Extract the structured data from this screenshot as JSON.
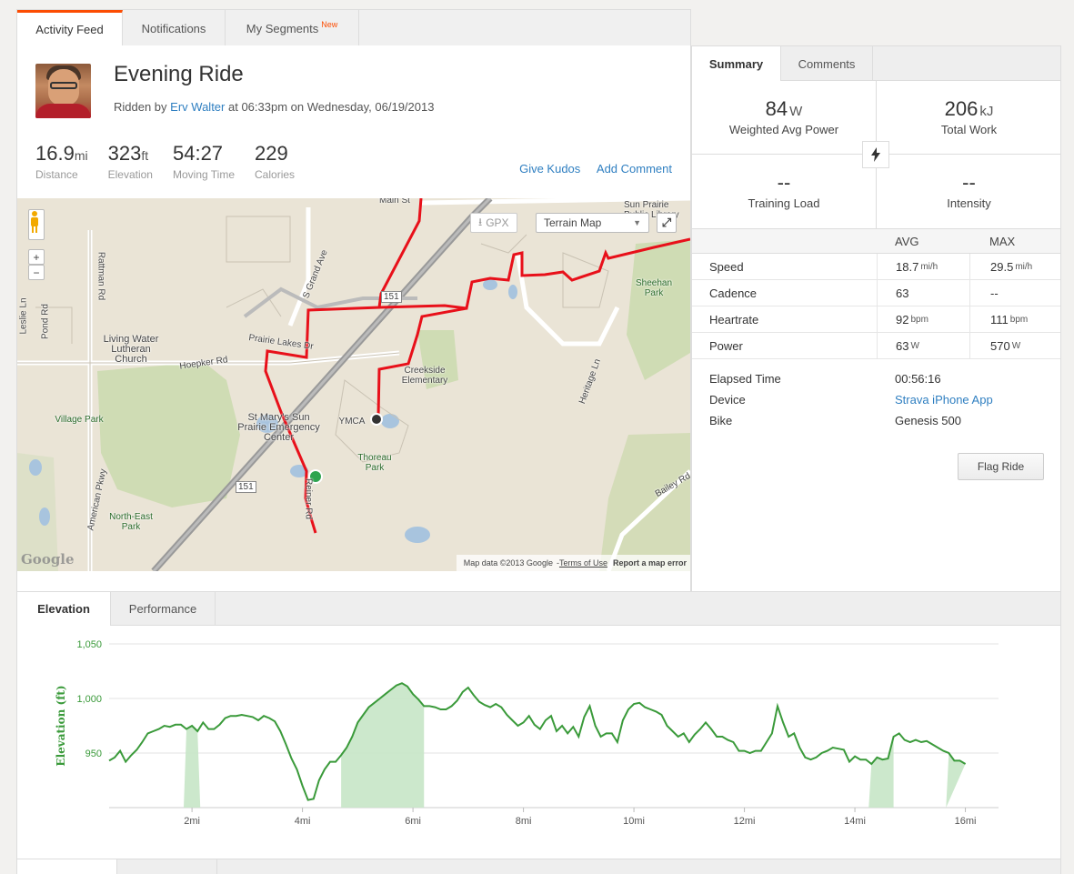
{
  "top_tabs": [
    {
      "label": "Activity Feed"
    },
    {
      "label": "Notifications"
    },
    {
      "label": "My Segments",
      "badge": "New"
    }
  ],
  "activity": {
    "title": "Evening Ride",
    "ridden_by_prefix": "Ridden by",
    "athlete": "Erv Walter",
    "when": "at 06:33pm on Wednesday, 06/19/2013",
    "stats": [
      {
        "value": "16.9",
        "unit": "mi",
        "label": "Distance"
      },
      {
        "value": "323",
        "unit": "ft",
        "label": "Elevation"
      },
      {
        "value": "54:27",
        "unit": "",
        "label": "Moving Time"
      },
      {
        "value": "229",
        "unit": "",
        "label": "Calories"
      }
    ],
    "give_kudos": "Give Kudos",
    "add_comment": "Add Comment"
  },
  "map": {
    "gpx": "GPX",
    "map_type": "Terrain Map",
    "zoom_in": "+",
    "zoom_out": "−",
    "labels": {
      "main_st": "Main St",
      "sun_prairie_library": "Sun Prairie Public Library",
      "rattman_rd": "Rattman Rd",
      "leslie_ln": "Leslie Ln",
      "pond_rd": "Pond Rd",
      "s_grand_ave": "S Grand Ave",
      "hwy151": "151",
      "hwy151b": "151",
      "sheehan_park": "Sheehan Park",
      "living_water": "Living Water Lutheran Church",
      "hoepker_rd": "Hoepker Rd",
      "prairie_lakes_dr": "Prairie Lakes Dr",
      "creekside": "Creekside Elementary",
      "heritage_ln": "Heritage Ln",
      "village_park": "Village Park",
      "st_marys": "St Mary's Sun Prairie Emergency Center",
      "ymca": "YMCA",
      "thoreau_park": "Thoreau Park",
      "american_pkwy": "American Pkwy",
      "reiner_rd": "Reiner Rd",
      "north_east_park": "North-East Park",
      "bailey_rd": "Bailey Rd"
    },
    "google": "Google",
    "map_data": "Map data ©2013 Google",
    "terms": "Terms of Use",
    "report": "Report a map error",
    "route_color": "#e8101a"
  },
  "right": {
    "tabs": [
      {
        "label": "Summary"
      },
      {
        "label": "Comments"
      }
    ],
    "kpis": [
      {
        "value": "84",
        "unit": "W",
        "label": "Weighted Avg Power"
      },
      {
        "value": "206",
        "unit": "kJ",
        "label": "Total Work"
      },
      {
        "value": "--",
        "unit": "",
        "label": "Training Load"
      },
      {
        "value": "--",
        "unit": "",
        "label": "Intensity"
      }
    ],
    "table_head": {
      "avg": "AVG",
      "max": "MAX"
    },
    "rows": [
      {
        "label": "Speed",
        "avg": "18.7",
        "avg_unit": "mi/h",
        "max": "29.5",
        "max_unit": "mi/h"
      },
      {
        "label": "Cadence",
        "avg": "63",
        "avg_unit": "",
        "max": "--",
        "max_unit": ""
      },
      {
        "label": "Heartrate",
        "avg": "92",
        "avg_unit": "bpm",
        "max": "111",
        "max_unit": "bpm"
      },
      {
        "label": "Power",
        "avg": "63",
        "avg_unit": "W",
        "max": "570",
        "max_unit": "W"
      }
    ],
    "meta": [
      {
        "key": "Elapsed Time",
        "value": "00:56:16"
      },
      {
        "key": "Device",
        "value": "Strava iPhone App"
      },
      {
        "key": "Bike",
        "value": "Genesis 500"
      }
    ],
    "flag_ride": "Flag Ride"
  },
  "chart_tabs": [
    {
      "label": "Elevation"
    },
    {
      "label": "Performance"
    }
  ],
  "bottom_tabs": [
    {
      "label": ""
    },
    {
      "label": ""
    }
  ],
  "chart_data": {
    "type": "area",
    "ylabel": "Elevation (ft)",
    "xlabel": "",
    "ylim": [
      900,
      1050
    ],
    "xlim": [
      0.5,
      16.6
    ],
    "y_ticks": [
      "950",
      "1,000",
      "1,050"
    ],
    "y_tick_values": [
      950,
      1000,
      1050
    ],
    "x_ticks": [
      "2mi",
      "4mi",
      "6mi",
      "8mi",
      "10mi",
      "12mi",
      "14mi",
      "16mi"
    ],
    "x_tick_values": [
      2,
      4,
      6,
      8,
      10,
      12,
      14,
      16
    ],
    "line_color": "#3a9a3a",
    "fill_color": "#c7e6c7",
    "x": [
      0.5,
      0.6,
      0.7,
      0.8,
      0.9,
      1.0,
      1.1,
      1.2,
      1.3,
      1.4,
      1.5,
      1.6,
      1.7,
      1.8,
      1.9,
      2.0,
      2.1,
      2.2,
      2.3,
      2.4,
      2.5,
      2.6,
      2.7,
      2.8,
      2.9,
      3.0,
      3.1,
      3.2,
      3.3,
      3.4,
      3.5,
      3.6,
      3.7,
      3.8,
      3.9,
      4.0,
      4.1,
      4.2,
      4.3,
      4.4,
      4.5,
      4.6,
      4.7,
      4.8,
      4.9,
      5.0,
      5.1,
      5.2,
      5.3,
      5.4,
      5.5,
      5.6,
      5.7,
      5.8,
      5.9,
      6.0,
      6.1,
      6.2,
      6.3,
      6.4,
      6.5,
      6.6,
      6.7,
      6.8,
      6.9,
      7.0,
      7.1,
      7.2,
      7.3,
      7.4,
      7.5,
      7.6,
      7.7,
      7.8,
      7.9,
      8.0,
      8.1,
      8.2,
      8.3,
      8.4,
      8.5,
      8.6,
      8.7,
      8.8,
      8.9,
      9.0,
      9.1,
      9.2,
      9.3,
      9.4,
      9.5,
      9.6,
      9.7,
      9.8,
      9.9,
      10.0,
      10.1,
      10.2,
      10.3,
      10.4,
      10.5,
      10.6,
      10.7,
      10.8,
      10.9,
      11.0,
      11.1,
      11.2,
      11.3,
      11.4,
      11.5,
      11.6,
      11.7,
      11.8,
      11.9,
      12.0,
      12.1,
      12.2,
      12.3,
      12.4,
      12.5,
      12.6,
      12.7,
      12.8,
      12.9,
      13.0,
      13.1,
      13.2,
      13.3,
      13.4,
      13.5,
      13.6,
      13.7,
      13.8,
      13.9,
      14.0,
      14.1,
      14.2,
      14.3,
      14.4,
      14.5,
      14.6,
      14.7,
      14.8,
      14.9,
      15.0,
      15.1,
      15.2,
      15.3,
      15.4,
      15.5,
      15.6,
      15.7,
      15.8,
      15.9,
      16.0,
      16.1,
      16.2,
      16.3,
      16.4,
      16.5,
      16.6
    ],
    "values": [
      943,
      946,
      952,
      942,
      948,
      953,
      960,
      968,
      970,
      972,
      975,
      974,
      976,
      976,
      972,
      975,
      970,
      978,
      972,
      972,
      976,
      982,
      984,
      984,
      985,
      984,
      983,
      980,
      984,
      982,
      979,
      970,
      958,
      945,
      935,
      920,
      907,
      908,
      925,
      935,
      942,
      942,
      948,
      955,
      965,
      978,
      985,
      992,
      996,
      1000,
      1004,
      1008,
      1012,
      1014,
      1011,
      1004,
      999,
      993,
      993,
      992,
      990,
      990,
      993,
      998,
      1006,
      1010,
      1003,
      997,
      994,
      992,
      995,
      992,
      985,
      980,
      975,
      978,
      984,
      976,
      972,
      980,
      984,
      970,
      975,
      968,
      974,
      965,
      983,
      993,
      975,
      965,
      968,
      968,
      960,
      980,
      990,
      995,
      996,
      992,
      990,
      988,
      985,
      975,
      970,
      965,
      968,
      960,
      967,
      972,
      978,
      972,
      965,
      965,
      962,
      960,
      952,
      952,
      950,
      952,
      952,
      960,
      968,
      993,
      978,
      965,
      968,
      955,
      946,
      944,
      946,
      950,
      952,
      955,
      954,
      953,
      942,
      947,
      944,
      944,
      940,
      946,
      944,
      945,
      965,
      968,
      962,
      960,
      962,
      960,
      961,
      958,
      955,
      952,
      950,
      943,
      943,
      940
    ]
  }
}
